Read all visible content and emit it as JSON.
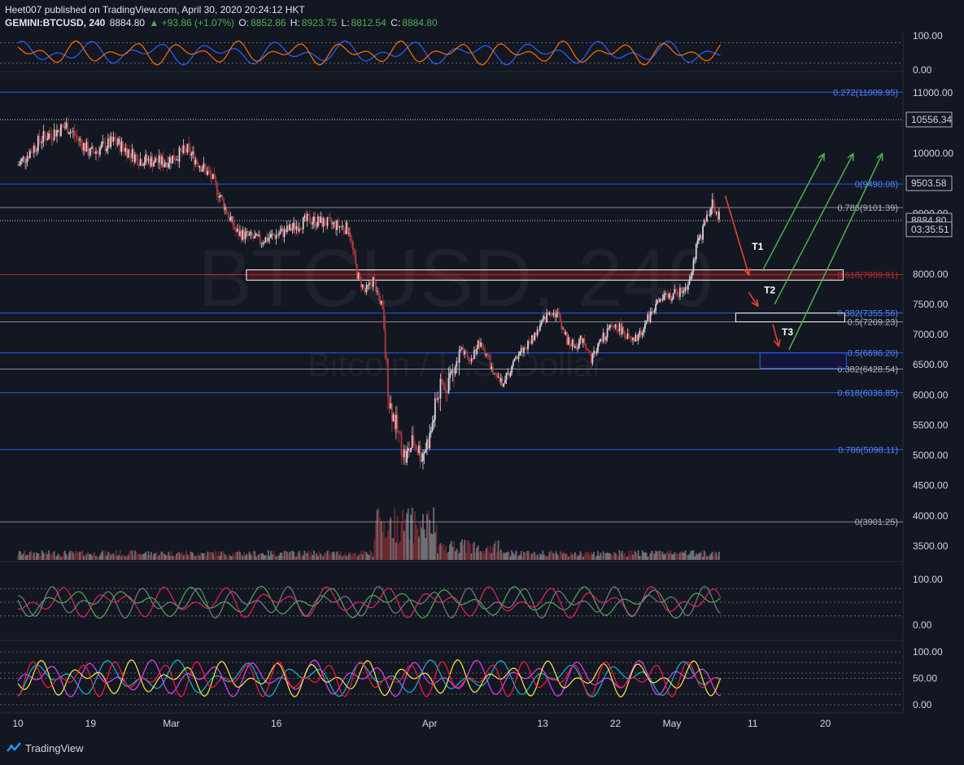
{
  "header": {
    "line1": "Heet007 published on TradingView.com, April 30, 2020 20:24:12 HKT",
    "symbol": "GEMINI:BTCUSD, 240",
    "last": "8884.80",
    "change": "▲ +93.86 (+1.07%)",
    "o_label": "O:",
    "o": "8852.86",
    "h_label": "H:",
    "h": "8923.75",
    "l_label": "L:",
    "l": "8812.54",
    "c_label": "C:",
    "c": "8884.80"
  },
  "watermark": {
    "symbol": "BTCUSD, 240",
    "name": "Bitcoin / U.S. Dollar"
  },
  "footer": {
    "brand": "TradingView"
  },
  "colors": {
    "background": "#131722",
    "fib_blue": "#2962ff",
    "fib_red": "#c62828",
    "up": "#d1d4dc",
    "down": "#b23a3a",
    "arrow_green": "#4caf50",
    "arrow_red": "#f44336"
  },
  "chart_data": {
    "type": "candlestick",
    "ylim": [
      3300,
      11300
    ],
    "x_ticks": [
      "10",
      "19",
      "Mar",
      "16",
      "Apr",
      "13",
      "22",
      "May",
      "11",
      "20"
    ],
    "y_ticks": [
      "11000.00",
      "10000.00",
      "9000.00",
      "8000.00",
      "7500.00",
      "7000.00",
      "6500.00",
      "6000.00",
      "5500.00",
      "5000.00",
      "4500.00",
      "4000.00",
      "3500.00"
    ],
    "price_labels": [
      {
        "text": "10556.34",
        "value": 10556.34
      },
      {
        "text": "9503.58",
        "value": 9503.58
      },
      {
        "text": "8884.80",
        "value": 8884.8
      },
      {
        "text": "03:35:51",
        "value": 8740
      }
    ],
    "fib_levels": [
      {
        "label": "0.272(11009.95)",
        "value": 11009.95,
        "color": "#2962ff"
      },
      {
        "label": "0(9490.08)",
        "value": 9490.08,
        "color": "#2962ff"
      },
      {
        "label": "0.786(9101.39)",
        "value": 9101.39,
        "color": "#9598a1"
      },
      {
        "label": "0.618(7989.91)",
        "value": 7989.91,
        "color": "#c62828"
      },
      {
        "label": "0.382(7355.56)",
        "value": 7355.56,
        "color": "#2962ff"
      },
      {
        "label": "0.5(7209.23)",
        "value": 7209.23,
        "color": "#9598a1"
      },
      {
        "label": "0.5(6696.20)",
        "value": 6696.2,
        "color": "#2962ff"
      },
      {
        "label": "0.382(6428.54)",
        "value": 6428.54,
        "color": "#9598a1"
      },
      {
        "label": "0.618(6036.85)",
        "value": 6036.85,
        "color": "#2962ff"
      },
      {
        "label": "0.786(5098.11)",
        "value": 5098.11,
        "color": "#2962ff"
      },
      {
        "label": "0(3901.25)",
        "value": 3901.25,
        "color": "#9598a1"
      }
    ],
    "price_path": [
      [
        0,
        9800
      ],
      [
        3,
        10250
      ],
      [
        6,
        10450
      ],
      [
        9,
        10000
      ],
      [
        12,
        10200
      ],
      [
        15,
        9900
      ],
      [
        18,
        9850
      ],
      [
        21,
        10050
      ],
      [
        24,
        9600
      ],
      [
        27,
        8700
      ],
      [
        30,
        8550
      ],
      [
        33,
        8700
      ],
      [
        36,
        8900
      ],
      [
        38,
        8850
      ],
      [
        41,
        8750
      ],
      [
        42,
        8000
      ],
      [
        43,
        7700
      ],
      [
        44,
        7900
      ],
      [
        45,
        7500
      ],
      [
        46,
        5900
      ],
      [
        47,
        5400
      ],
      [
        48,
        4950
      ],
      [
        49,
        5250
      ],
      [
        50,
        5000
      ],
      [
        51,
        5300
      ],
      [
        52,
        6000
      ],
      [
        53,
        6200
      ],
      [
        54,
        6400
      ],
      [
        55,
        6700
      ],
      [
        56,
        6550
      ],
      [
        57,
        6850
      ],
      [
        58,
        6700
      ],
      [
        59,
        6300
      ],
      [
        60,
        6200
      ],
      [
        61,
        6400
      ],
      [
        62,
        6700
      ],
      [
        63,
        6800
      ],
      [
        64,
        7000
      ],
      [
        65,
        7200
      ],
      [
        66,
        7400
      ],
      [
        67,
        7300
      ],
      [
        68,
        6900
      ],
      [
        69,
        6800
      ],
      [
        70,
        6950
      ],
      [
        71,
        6600
      ],
      [
        72,
        6850
      ],
      [
        73,
        7050
      ],
      [
        74,
        7150
      ],
      [
        75,
        7050
      ],
      [
        76,
        6850
      ],
      [
        77,
        7000
      ],
      [
        78,
        7250
      ],
      [
        79,
        7500
      ],
      [
        80,
        7600
      ],
      [
        81,
        7650
      ],
      [
        82,
        7700
      ],
      [
        83,
        7850
      ],
      [
        84,
        8400
      ],
      [
        85,
        8800
      ],
      [
        86,
        9200
      ],
      [
        87,
        8880
      ]
    ],
    "day_range": [
      0,
      87
    ],
    "arrows": [
      {
        "color": "#f44336",
        "from": [
          87.6,
          9300
        ],
        "to": [
          90.5,
          8000
        ]
      },
      {
        "color": "#f44336",
        "from": [
          90.5,
          7700
        ],
        "to": [
          91.6,
          7480
        ]
      },
      {
        "color": "#f44336",
        "from": [
          93.5,
          7170
        ],
        "to": [
          94.2,
          6820
        ]
      },
      {
        "color": "#4caf50",
        "from": [
          92.2,
          8050
        ],
        "to": [
          99.8,
          9980
        ]
      },
      {
        "color": "#4caf50",
        "from": [
          93.7,
          7500
        ],
        "to": [
          103.4,
          9980
        ]
      },
      {
        "color": "#4caf50",
        "from": [
          95.5,
          6750
        ],
        "to": [
          107,
          9980
        ]
      }
    ],
    "targets": [
      {
        "label": "T1",
        "x": 90.9,
        "y": 8400
      },
      {
        "label": "T2",
        "x": 92.4,
        "y": 7680
      },
      {
        "label": "T3",
        "x": 94.6,
        "y": 6990
      }
    ],
    "zones": [
      {
        "x0": 28.3,
        "x1": 102.2,
        "y0": 7900,
        "y1": 8070,
        "stroke": "#ffffff",
        "fill": "rgba(198,40,40,0.25)"
      },
      {
        "x0": 88.9,
        "x1": 102.4,
        "y0": 7210,
        "y1": 7355,
        "stroke": "#ffffff",
        "fill": "rgba(19,23,34,0.5)"
      },
      {
        "x0": 91.9,
        "x1": 102.6,
        "y0": 6440,
        "y1": 6695,
        "stroke": "#2962ff",
        "fill": "rgba(20,20,80,0.5)"
      }
    ],
    "top_osc": {
      "ticks": [
        "100.00",
        "0.00"
      ],
      "levels": [
        80,
        20
      ]
    },
    "mid_osc": {
      "ticks": [
        "100.00",
        "0.00"
      ],
      "levels": [
        80,
        50,
        20
      ]
    },
    "bottom_osc": {
      "ticks": [
        "100.00",
        "50.00",
        "0.00"
      ],
      "levels": [
        100,
        80,
        60,
        50,
        20,
        0
      ]
    }
  }
}
